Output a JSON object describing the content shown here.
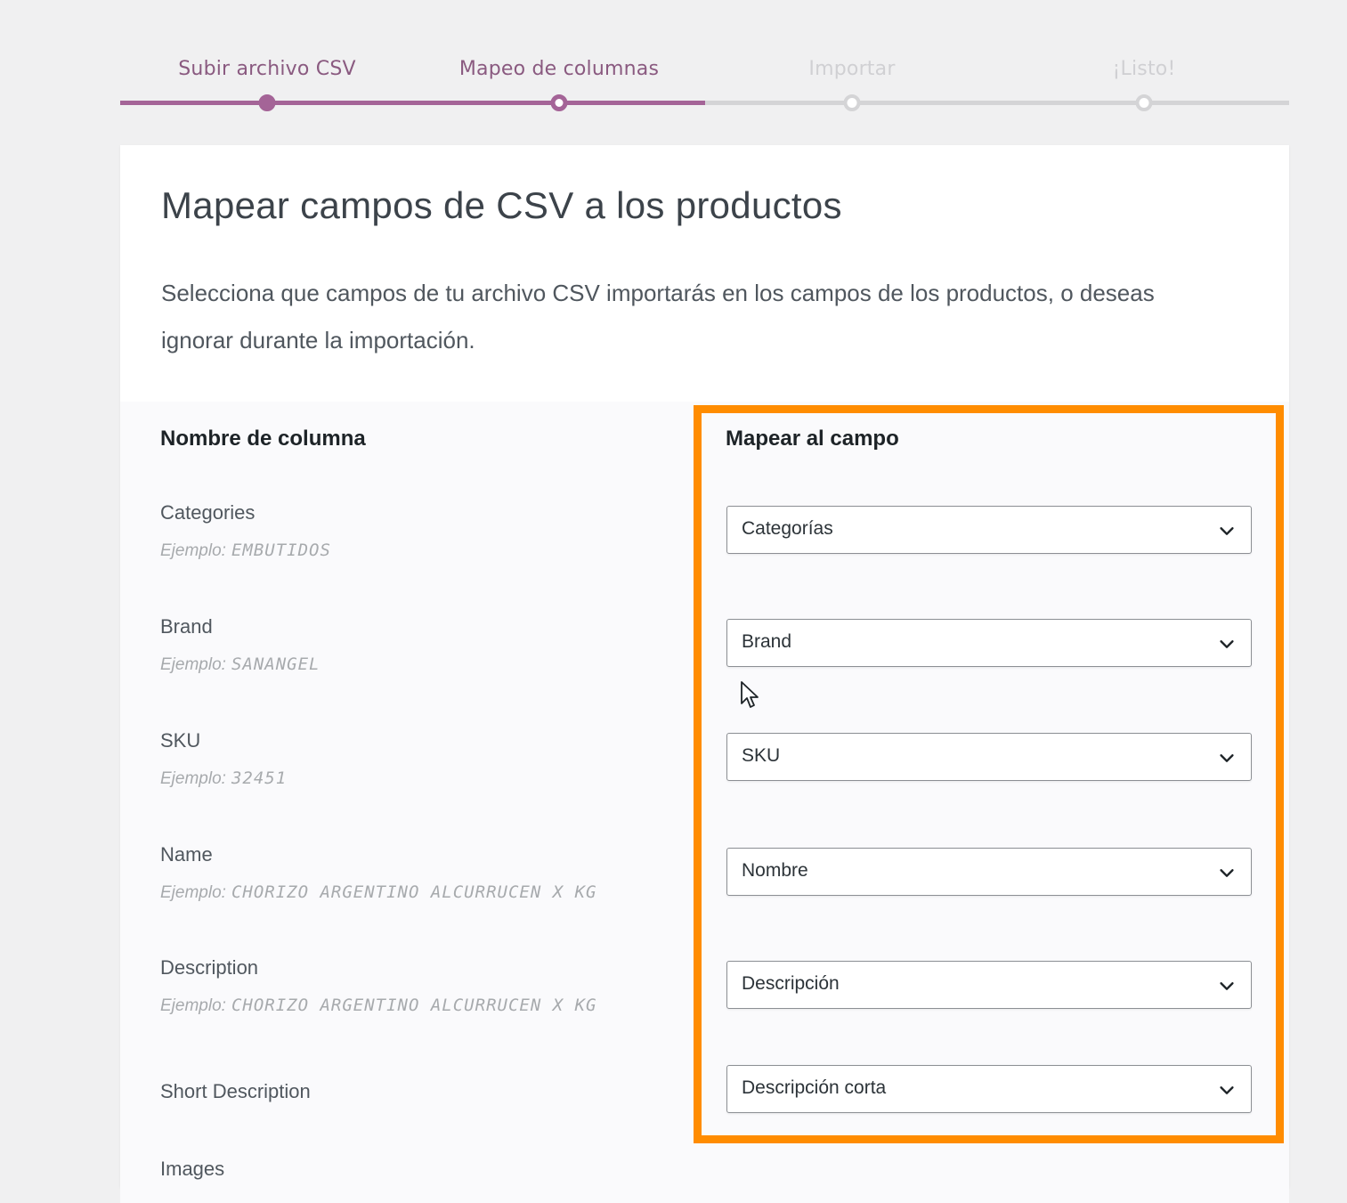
{
  "stepper": {
    "steps": [
      {
        "label": "Subir archivo CSV",
        "state": "done"
      },
      {
        "label": "Mapeo de columnas",
        "state": "active"
      },
      {
        "label": "Importar",
        "state": "todo"
      },
      {
        "label": "¡Listo!",
        "state": "todo"
      }
    ],
    "progress_percent": 50
  },
  "card": {
    "title": "Mapear campos de CSV a los productos",
    "description": "Selecciona que campos de tu archivo CSV importarás en los campos de los productos, o deseas ignorar durante la importación."
  },
  "mapping": {
    "column_header": "Nombre de columna",
    "field_header": "Mapear al campo",
    "rows": [
      {
        "name": "Categories",
        "example_prefix": "Ejemplo:",
        "example_value": "EMBUTIDOS",
        "mapped": "Categorías"
      },
      {
        "name": "Brand",
        "example_prefix": "Ejemplo:",
        "example_value": "SANANGEL",
        "mapped": "Brand"
      },
      {
        "name": "SKU",
        "example_prefix": "Ejemplo:",
        "example_value": "32451",
        "mapped": "SKU"
      },
      {
        "name": "Name",
        "example_prefix": "Ejemplo:",
        "example_value": "CHORIZO ARGENTINO ALCURRUCEN X KG",
        "mapped": "Nombre"
      },
      {
        "name": "Description",
        "example_prefix": "Ejemplo:",
        "example_value": "CHORIZO ARGENTINO ALCURRUCEN X KG",
        "mapped": "Descripción"
      },
      {
        "name": "Short Description",
        "example_prefix": "",
        "example_value": "",
        "mapped": "Descripción corta"
      }
    ],
    "next_row_partial": "Images"
  },
  "icons": {
    "dropdown": "chevron-down-icon",
    "cursor": "mouse-pointer-icon"
  },
  "colors": {
    "accent": "#a46497",
    "highlight": "#ff8c00",
    "track": "#d4d4d6"
  }
}
